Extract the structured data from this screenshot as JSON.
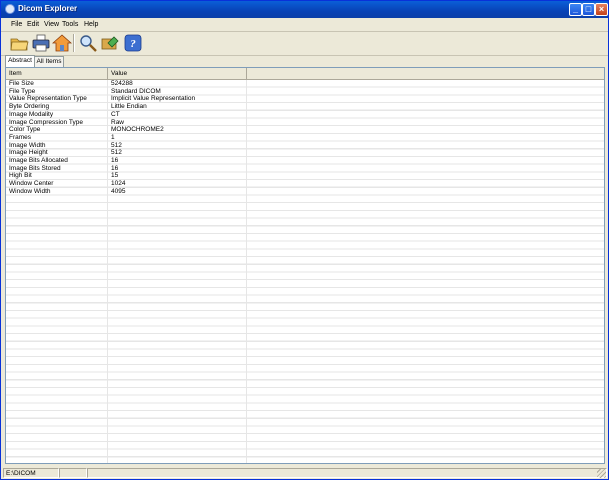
{
  "window": {
    "title": "Dicom Explorer"
  },
  "menu": {
    "items": [
      "File",
      "Edit",
      "View",
      "Tools",
      "Help"
    ]
  },
  "toolbar": {
    "icons": [
      "open-folder-icon",
      "print-icon",
      "home-icon",
      "zoom-icon",
      "export-icon",
      "help-icon"
    ]
  },
  "tabs": [
    {
      "label": "Abstract",
      "active": true
    },
    {
      "label": "All Items",
      "active": false
    }
  ],
  "table": {
    "columns": [
      "Item",
      "Value"
    ],
    "rows": [
      [
        "File Size",
        "524288"
      ],
      [
        "File Type",
        "Standard DICOM"
      ],
      [
        "Value Representation Type",
        "Implicit Value Representation"
      ],
      [
        "Byte Ordering",
        "Little Endian"
      ],
      [
        "Image Modality",
        "CT"
      ],
      [
        "Image Compression Type",
        "Raw"
      ],
      [
        "Color Type",
        "MONOCHROME2"
      ],
      [
        "Frames",
        "1"
      ],
      [
        "Image Width",
        "512"
      ],
      [
        "Image Height",
        "512"
      ],
      [
        "Image Bits Allocated",
        "16"
      ],
      [
        "Image Bits Stored",
        "16"
      ],
      [
        "High Bit",
        "15"
      ],
      [
        "Window Center",
        "1024"
      ],
      [
        "Window Width",
        "4095"
      ]
    ]
  },
  "statusbar": {
    "path": "E:\\DICOM"
  },
  "colors": {
    "title_bar": "#0842b6",
    "window_bg": "#ece9d8",
    "grid_line": "#e6e6e6"
  }
}
